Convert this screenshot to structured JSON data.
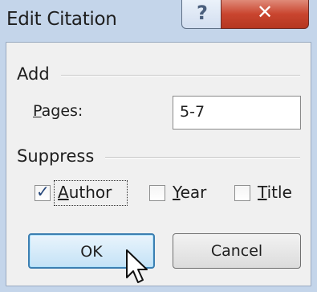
{
  "window": {
    "title": "Edit Citation",
    "help_glyph": "?",
    "close_glyph": "✕"
  },
  "add_group": {
    "label": "Add",
    "pages_label_accel": "P",
    "pages_label_rest": "ages:",
    "pages_value": "5-7"
  },
  "suppress_group": {
    "label": "Suppress",
    "author": {
      "accel": "A",
      "rest": "uthor",
      "checked": true
    },
    "year": {
      "accel": "Y",
      "rest": "ear",
      "checked": false
    },
    "title": {
      "accel": "T",
      "rest": "itle",
      "checked": false
    },
    "check_glyph": "✓"
  },
  "buttons": {
    "ok_label": "OK",
    "cancel_label": "Cancel"
  },
  "colors": {
    "title_bar": "#c4d5ea",
    "close_button": "#c9452f",
    "ok_button_border": "#3c7fb1"
  },
  "icons": {
    "help": "help-icon",
    "close": "close-icon",
    "check": "checkmark-icon",
    "cursor": "mouse-pointer-icon"
  }
}
